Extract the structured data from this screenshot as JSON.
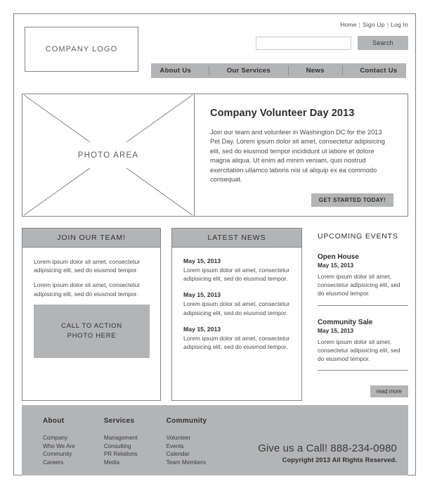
{
  "utility_nav": {
    "items": [
      "Home",
      "Sign Up",
      "Log In"
    ],
    "separator": "|"
  },
  "logo": {
    "label": "COMPANY LOGO"
  },
  "search": {
    "value": "",
    "placeholder": "",
    "button_label": "Search"
  },
  "main_nav": {
    "items": [
      "About Us",
      "Our Services",
      "News",
      "Contact Us"
    ]
  },
  "hero": {
    "photo_label": "PHOTO AREA",
    "title": "Company Volunteer Day 2013",
    "body": "Join our team and volunteer in Washington DC for the 2013 Pet Day. Lorem ipsum dolor sit amet, consectetur adipisicing elit, sed do eiusmod tempor incididunt ut labore et dolore magna aliqua. Ut enim ad minim veniam, quis nostrud exercitation ullamco laboris nisi ut aliquip ex ea commodo consequat.",
    "cta_label": "GET STARTED TODAY!"
  },
  "join_panel": {
    "heading": "JOIN OUR TEAM!",
    "paragraphs": [
      "Lorem ipsum dolor sit amet, consectetur adipisicing elit, sed do eiusmod tempor.",
      "Lorem ipsum dolor sit amet, consectetur adipisicing elit, sed do eiusmod tempor."
    ],
    "cta_photo_line1": "CALL TO ACTION",
    "cta_photo_line2": "PHOTO HERE"
  },
  "news_panel": {
    "heading": "LATEST NEWS",
    "items": [
      {
        "date": "May 15, 2013",
        "text": "Lorem ipsum dolor sit amet, consectetur adipisicing elit, sed do eiusmod tempor."
      },
      {
        "date": "May 15, 2013",
        "text": "Lorem ipsum dolor sit amet, consectetur adipisicing elit, sed do eiusmod tempor."
      },
      {
        "date": "May 15, 2013",
        "text": "Lorem ipsum dolor sit amet, consectetur adipisicing elit, sed do eiusmod tempor."
      }
    ]
  },
  "events_panel": {
    "heading": "UPCOMING EVENTS",
    "items": [
      {
        "title": "Open House",
        "date": "May 15, 2013",
        "text": "Lorem ipsum dolor sit amet, consectetur adipisicing elit, sed do eiusmod tempor."
      },
      {
        "title": "Community Sale",
        "date": "May 15, 2013",
        "text": "Lorem ipsum dolor sit amet, consectetur adipisicing elit, sed do eiusmod tempor."
      }
    ],
    "read_more_label": "read more"
  },
  "footer": {
    "columns": [
      {
        "title": "About",
        "links": [
          "Company",
          "Who We Are",
          "Community",
          "Careers"
        ]
      },
      {
        "title": "Services",
        "links": [
          "Management",
          "Consulting",
          "PR Relations",
          "Media"
        ]
      },
      {
        "title": "Community",
        "links": [
          "Volunteer",
          "Events",
          "Calendar",
          "Team Members"
        ]
      }
    ],
    "call_line": "Give us a Call! 888-234-0980",
    "copyright": "Copyright 2013 All Rights Reserved."
  },
  "colors": {
    "accent_gray": "#b3b4b6",
    "border_gray": "#808285",
    "text_dark": "#2f2f2f"
  }
}
